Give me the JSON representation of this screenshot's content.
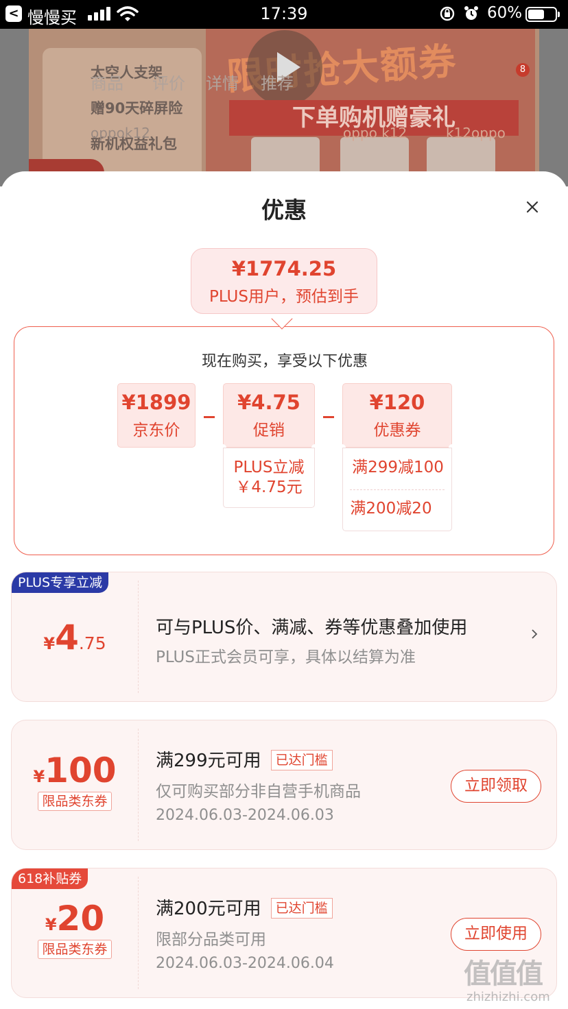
{
  "status_bar": {
    "back_glyph": "<",
    "app": "慢慢买",
    "time": "17:39",
    "battery": "60%",
    "battery_level": 0.6
  },
  "background_page": {
    "tabs": [
      "商品",
      "评价",
      "详情",
      "推荐"
    ],
    "headline": "限时抢大额券",
    "gift_bar": "下单购机赠豪礼",
    "left_lines": [
      "太空人支架",
      "赠90天碎屏险",
      "新机权益礼包"
    ],
    "thumb_labels": [
      "oppo k12",
      "k12oppo"
    ],
    "faint_label": "oppok12",
    "badge": "8"
  },
  "sheet": {
    "title": "优惠",
    "close_icon": "close-icon"
  },
  "estimate": {
    "price": "¥1774.25",
    "label": "PLUS用户，预估到手"
  },
  "calc": {
    "title": "现在购买，享受以下优惠",
    "base": {
      "amount": "¥1899",
      "label": "京东价"
    },
    "promo": {
      "amount": "¥4.75",
      "label": "促销",
      "details": [
        "PLUS立减",
        "￥4.75元"
      ]
    },
    "coupon": {
      "amount": "¥120",
      "label": "优惠券",
      "details": [
        "满299减100",
        "满200减20"
      ]
    }
  },
  "plus_card": {
    "tag": "PLUS专享立减",
    "currency": "¥",
    "amount_int": "4",
    "amount_dec": ".75",
    "title": "可与PLUS价、满减、券等优惠叠加使用",
    "desc": "PLUS正式会员可享，具体以结算为准"
  },
  "coupon_cards": [
    {
      "currency": "¥",
      "amount": "100",
      "category": "限品类东券",
      "title": "满299元可用",
      "reach": "已达门槛",
      "desc": "仅可购买部分非自营手机商品",
      "date": "2024.06.03-2024.06.03",
      "action": "立即领取"
    },
    {
      "tag": "618补贴券",
      "currency": "¥",
      "amount": "20",
      "category": "限品类东券",
      "title": "满200元可用",
      "reach": "已达门槛",
      "desc": "限部分品类可用",
      "date": "2024.06.03-2024.06.04",
      "action": "立即使用"
    }
  ],
  "watermark": {
    "glyphs": "值值值",
    "site": "zhizhizhi.com"
  },
  "colors": {
    "accent": "#e0442f",
    "plus_tag": "#2b3aa6",
    "subsidy_tag": "#e5493a"
  }
}
